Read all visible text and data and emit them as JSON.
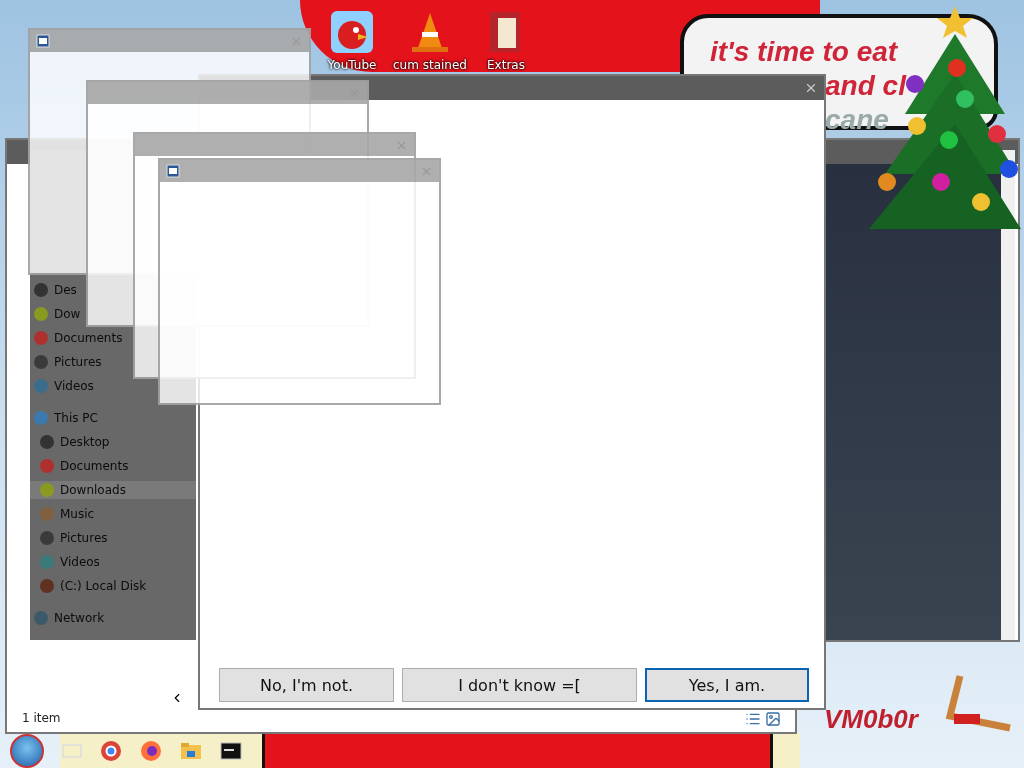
{
  "desktop_icons": [
    {
      "label": "YouTube"
    },
    {
      "label": "cum stained"
    },
    {
      "label": "Extras"
    }
  ],
  "wallpaper": {
    "bubble_lines": [
      "it's time to eat",
      "and cl",
      "cane"
    ],
    "signature": "VM0b0r"
  },
  "explorer": {
    "nav": [
      {
        "label": "Des",
        "selected": false
      },
      {
        "label": "Dow",
        "selected": false
      },
      {
        "label": "Documents",
        "selected": false
      },
      {
        "label": "Pictures",
        "selected": false
      },
      {
        "label": "Videos",
        "selected": false
      },
      {
        "label": "This PC",
        "selected": false,
        "children": [
          {
            "label": "Desktop",
            "selected": false
          },
          {
            "label": "Documents",
            "selected": false
          },
          {
            "label": "Downloads",
            "selected": true
          },
          {
            "label": "Music",
            "selected": false
          },
          {
            "label": "Pictures",
            "selected": false
          },
          {
            "label": "Videos",
            "selected": false
          },
          {
            "label": "(C:) Local Disk",
            "selected": false
          }
        ]
      },
      {
        "label": "Network",
        "selected": false
      }
    ],
    "status": "1 item"
  },
  "dialog": {
    "buttons": [
      {
        "label": "No, I'm not.",
        "selected": false
      },
      {
        "label": "I don't know =[",
        "selected": false
      },
      {
        "label": "Yes, I am.",
        "selected": true
      }
    ]
  }
}
